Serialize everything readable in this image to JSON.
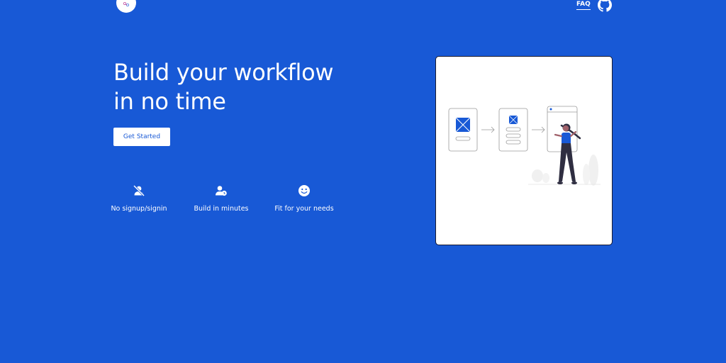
{
  "header": {
    "faq_label": "FAQ",
    "logo_icon": "logo-icon",
    "github_icon": "github-icon"
  },
  "hero": {
    "headline_line1": "Build your workflow",
    "headline_line2": "in no time",
    "cta_label": "Get Started"
  },
  "features": [
    {
      "label": "No signup/signin",
      "icon": "user-slash-icon"
    },
    {
      "label": "Build in minutes",
      "icon": "user-clock-icon"
    },
    {
      "label": "Fit for your needs",
      "icon": "smile-icon"
    }
  ],
  "illustration": {
    "name": "workflow-illustration"
  },
  "colors": {
    "background": "#1859d6",
    "text": "#ffffff",
    "accent": "#1859d6"
  }
}
